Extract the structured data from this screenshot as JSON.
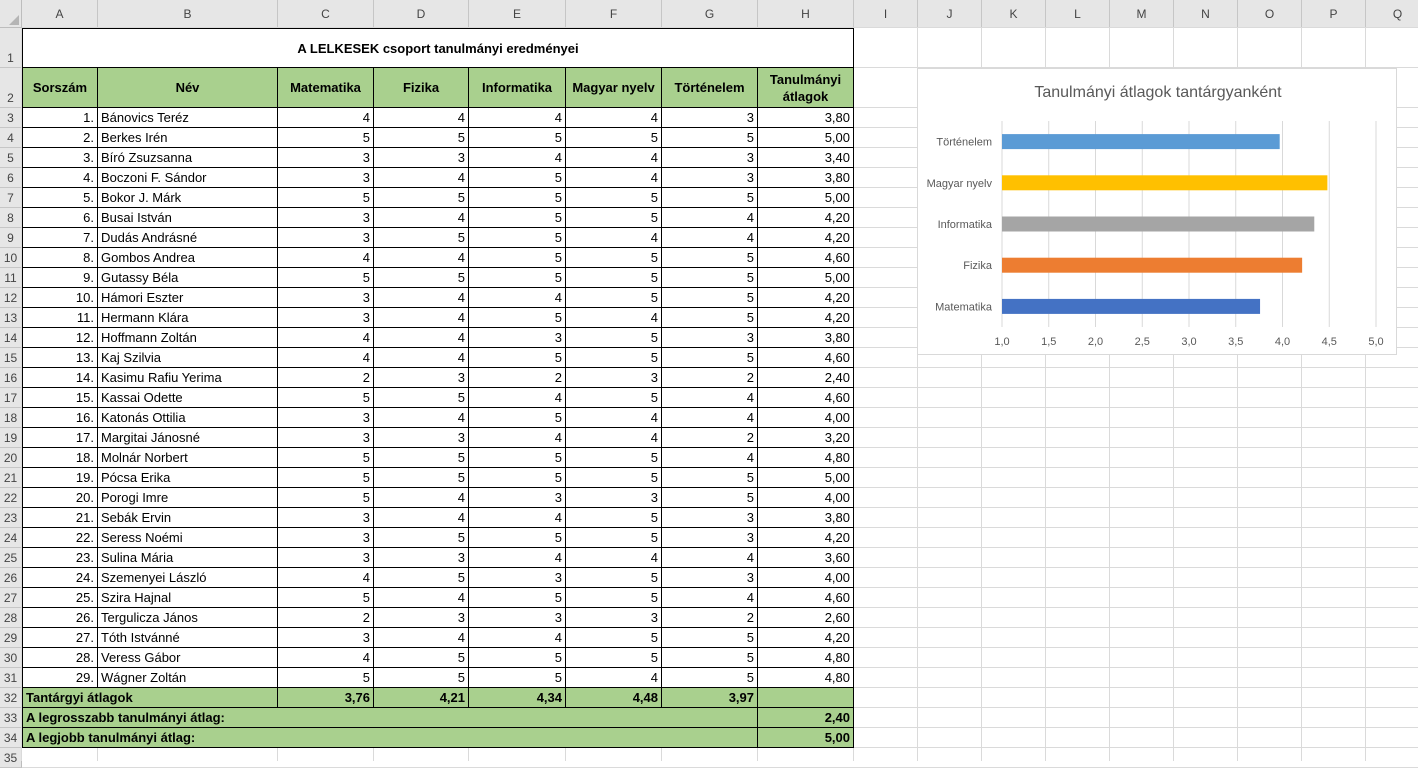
{
  "columns": [
    "A",
    "B",
    "C",
    "D",
    "E",
    "F",
    "G",
    "H",
    "I",
    "J",
    "K",
    "L",
    "M",
    "N",
    "O",
    "P",
    "Q"
  ],
  "rows": [
    "1",
    "2",
    "3",
    "4",
    "5",
    "6",
    "7",
    "8",
    "9",
    "10",
    "11",
    "12",
    "13",
    "14",
    "15",
    "16",
    "17",
    "18",
    "19",
    "20",
    "21",
    "22",
    "23",
    "24",
    "25",
    "26",
    "27",
    "28",
    "29",
    "30",
    "31",
    "32",
    "33",
    "34",
    "35"
  ],
  "title": "A LELKESEK csoport tanulmányi eredményei",
  "headers": [
    "Sorszám",
    "Név",
    "Matematika",
    "Fizika",
    "Informatika",
    "Magyar nyelv",
    "Történelem",
    "Tanulmányi átlagok"
  ],
  "students": [
    {
      "no": "1.",
      "name": "Bánovics Teréz",
      "g": [
        "4",
        "4",
        "4",
        "4",
        "3"
      ],
      "avg": "3,80"
    },
    {
      "no": "2.",
      "name": "Berkes Irén",
      "g": [
        "5",
        "5",
        "5",
        "5",
        "5"
      ],
      "avg": "5,00"
    },
    {
      "no": "3.",
      "name": "Bíró Zsuzsanna",
      "g": [
        "3",
        "3",
        "4",
        "4",
        "3"
      ],
      "avg": "3,40"
    },
    {
      "no": "4.",
      "name": "Boczoni F. Sándor",
      "g": [
        "3",
        "4",
        "5",
        "4",
        "3"
      ],
      "avg": "3,80"
    },
    {
      "no": "5.",
      "name": "Bokor J. Márk",
      "g": [
        "5",
        "5",
        "5",
        "5",
        "5"
      ],
      "avg": "5,00"
    },
    {
      "no": "6.",
      "name": "Busai István",
      "g": [
        "3",
        "4",
        "5",
        "5",
        "4"
      ],
      "avg": "4,20"
    },
    {
      "no": "7.",
      "name": "Dudás Andrásné",
      "g": [
        "3",
        "5",
        "5",
        "4",
        "4"
      ],
      "avg": "4,20"
    },
    {
      "no": "8.",
      "name": "Gombos Andrea",
      "g": [
        "4",
        "4",
        "5",
        "5",
        "5"
      ],
      "avg": "4,60"
    },
    {
      "no": "9.",
      "name": "Gutassy Béla",
      "g": [
        "5",
        "5",
        "5",
        "5",
        "5"
      ],
      "avg": "5,00"
    },
    {
      "no": "10.",
      "name": "Hámori Eszter",
      "g": [
        "3",
        "4",
        "4",
        "5",
        "5"
      ],
      "avg": "4,20"
    },
    {
      "no": "11.",
      "name": "Hermann Klára",
      "g": [
        "3",
        "4",
        "5",
        "4",
        "5"
      ],
      "avg": "4,20"
    },
    {
      "no": "12.",
      "name": "Hoffmann Zoltán",
      "g": [
        "4",
        "4",
        "3",
        "5",
        "3"
      ],
      "avg": "3,80"
    },
    {
      "no": "13.",
      "name": "Kaj Szilvia",
      "g": [
        "4",
        "4",
        "5",
        "5",
        "5"
      ],
      "avg": "4,60"
    },
    {
      "no": "14.",
      "name": "Kasimu Rafiu Yerima",
      "g": [
        "2",
        "3",
        "2",
        "3",
        "2"
      ],
      "avg": "2,40"
    },
    {
      "no": "15.",
      "name": "Kassai Odette",
      "g": [
        "5",
        "5",
        "4",
        "5",
        "4"
      ],
      "avg": "4,60"
    },
    {
      "no": "16.",
      "name": "Katonás Ottilia",
      "g": [
        "3",
        "4",
        "5",
        "4",
        "4"
      ],
      "avg": "4,00"
    },
    {
      "no": "17.",
      "name": "Margitai Jánosné",
      "g": [
        "3",
        "3",
        "4",
        "4",
        "2"
      ],
      "avg": "3,20"
    },
    {
      "no": "18.",
      "name": "Molnár Norbert",
      "g": [
        "5",
        "5",
        "5",
        "5",
        "4"
      ],
      "avg": "4,80"
    },
    {
      "no": "19.",
      "name": "Pócsa Erika",
      "g": [
        "5",
        "5",
        "5",
        "5",
        "5"
      ],
      "avg": "5,00"
    },
    {
      "no": "20.",
      "name": "Porogi Imre",
      "g": [
        "5",
        "4",
        "3",
        "3",
        "5"
      ],
      "avg": "4,00"
    },
    {
      "no": "21.",
      "name": "Sebák Ervin",
      "g": [
        "3",
        "4",
        "4",
        "5",
        "3"
      ],
      "avg": "3,80"
    },
    {
      "no": "22.",
      "name": "Seress Noémi",
      "g": [
        "3",
        "5",
        "5",
        "5",
        "3"
      ],
      "avg": "4,20"
    },
    {
      "no": "23.",
      "name": "Sulina Mária",
      "g": [
        "3",
        "3",
        "4",
        "4",
        "4"
      ],
      "avg": "3,60"
    },
    {
      "no": "24.",
      "name": "Szemenyei László",
      "g": [
        "4",
        "5",
        "3",
        "5",
        "3"
      ],
      "avg": "4,00"
    },
    {
      "no": "25.",
      "name": "Szira Hajnal",
      "g": [
        "5",
        "4",
        "5",
        "5",
        "4"
      ],
      "avg": "4,60"
    },
    {
      "no": "26.",
      "name": "Tergulicza János",
      "g": [
        "2",
        "3",
        "3",
        "3",
        "2"
      ],
      "avg": "2,60"
    },
    {
      "no": "27.",
      "name": "Tóth Istvánné",
      "g": [
        "3",
        "4",
        "4",
        "5",
        "5"
      ],
      "avg": "4,20"
    },
    {
      "no": "28.",
      "name": "Veress Gábor",
      "g": [
        "4",
        "5",
        "5",
        "5",
        "5"
      ],
      "avg": "4,80"
    },
    {
      "no": "29.",
      "name": "Wágner Zoltán",
      "g": [
        "5",
        "5",
        "5",
        "4",
        "5"
      ],
      "avg": "4,80"
    }
  ],
  "subject_avg_label": "Tantárgyi átlagok",
  "subject_avgs": [
    "3,76",
    "4,21",
    "4,34",
    "4,48",
    "3,97"
  ],
  "min_label": "A legrosszabb tanulmányi átlag:",
  "min_value": "2,40",
  "max_label": "A legjobb tanulmányi átlag:",
  "max_value": "5,00",
  "chart_data": {
    "type": "bar",
    "orientation": "horizontal",
    "title": "Tanulmányi átlagok tantárgyanként",
    "categories": [
      "Matematika",
      "Fizika",
      "Informatika",
      "Magyar nyelv",
      "Történelem"
    ],
    "values": [
      3.76,
      4.21,
      4.34,
      4.48,
      3.97
    ],
    "colors": [
      "#4472c4",
      "#ed7d31",
      "#a5a5a5",
      "#ffc000",
      "#5b9bd5"
    ],
    "xlim": [
      1.0,
      5.0
    ],
    "xticks": [
      "1,0",
      "1,5",
      "2,0",
      "2,5",
      "3,0",
      "3,5",
      "4,0",
      "4,5",
      "5,0"
    ],
    "grid": true,
    "legend": "none"
  }
}
